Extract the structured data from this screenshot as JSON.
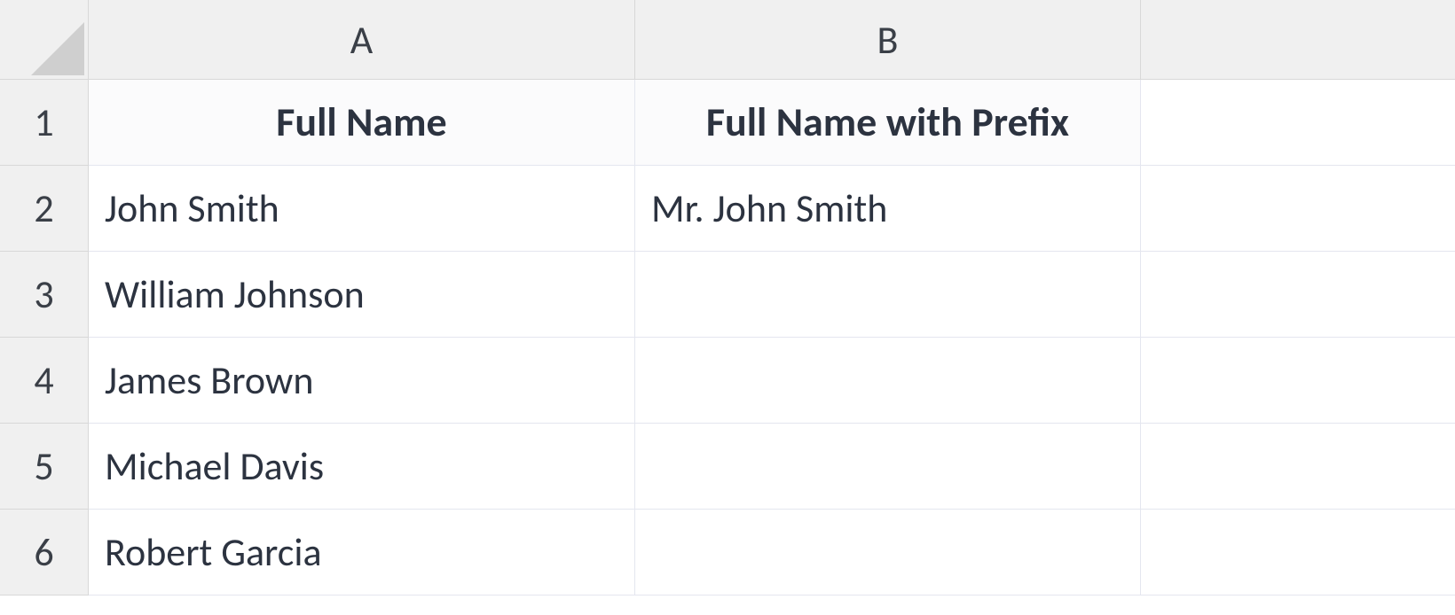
{
  "columns": [
    "A",
    "B"
  ],
  "row_numbers": [
    "1",
    "2",
    "3",
    "4",
    "5",
    "6"
  ],
  "headers": {
    "colA": "Full Name",
    "colB": "Full Name with Prefix"
  },
  "rows": [
    {
      "a": "John Smith",
      "b": "Mr. John Smith"
    },
    {
      "a": "William Johnson",
      "b": ""
    },
    {
      "a": "James Brown",
      "b": ""
    },
    {
      "a": "Michael Davis",
      "b": ""
    },
    {
      "a": "Robert Garcia",
      "b": ""
    }
  ]
}
